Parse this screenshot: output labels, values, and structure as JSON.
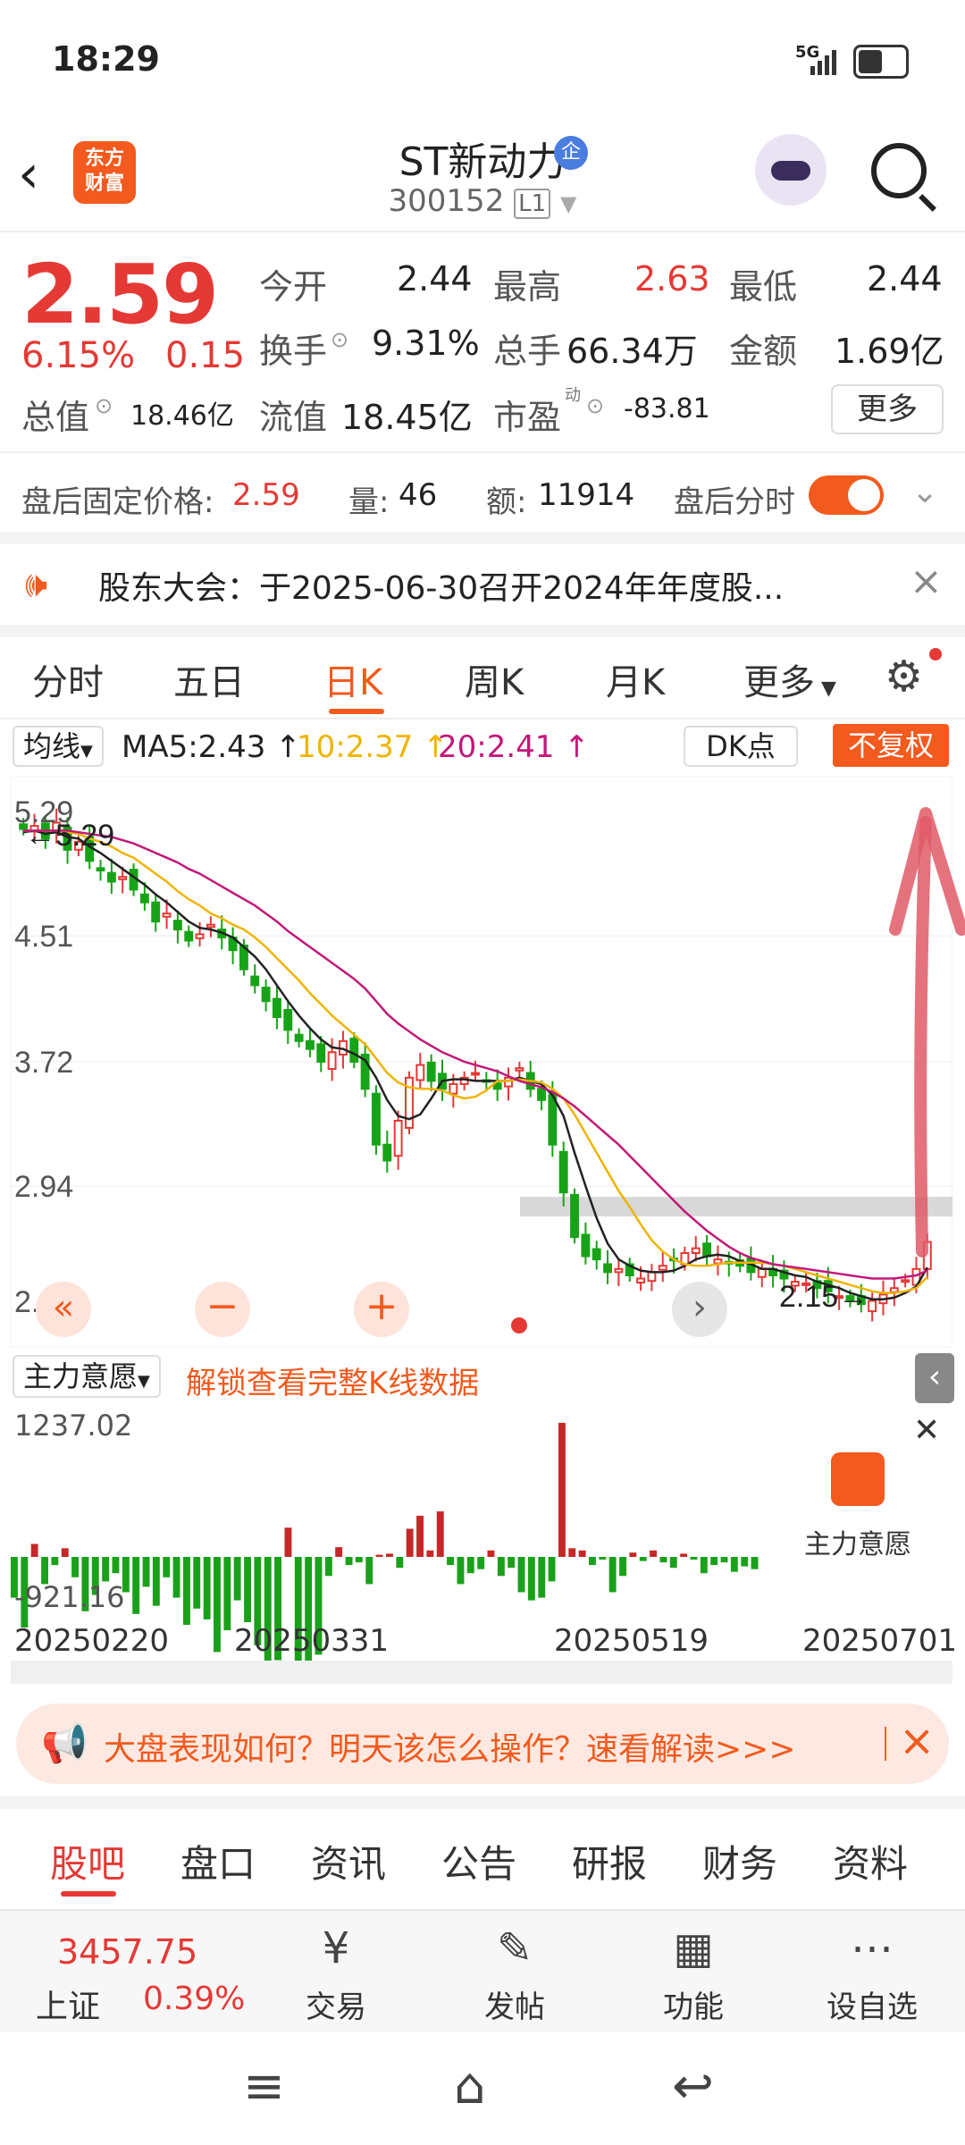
{
  "status": {
    "time": "18:29",
    "network": "5G"
  },
  "header": {
    "logo_line1": "东方",
    "logo_line2": "财富",
    "name": "ST新动力",
    "qi_badge": "企",
    "code": "300152",
    "level": "L1"
  },
  "quote": {
    "price": "2.59",
    "pct": "6.15%",
    "chg": "0.15",
    "row1": [
      {
        "label": "今开",
        "value": "2.44"
      },
      {
        "label": "最高",
        "value": "2.63"
      },
      {
        "label": "最低",
        "value": "2.44"
      }
    ],
    "row2": [
      {
        "label": "换手",
        "value": "9.31%"
      },
      {
        "label": "总手",
        "value": "66.34万"
      },
      {
        "label": "金额",
        "value": "1.69亿"
      }
    ],
    "row3": [
      {
        "label": "总值",
        "value": "18.46亿"
      },
      {
        "label": "流值",
        "value": "18.45亿"
      },
      {
        "label": "市盈",
        "sup": "动",
        "value": "-83.81"
      }
    ],
    "more": "更多"
  },
  "after_hours": {
    "price_label": "盘后固定价格:",
    "price": "2.59",
    "vol_label": "量:",
    "vol": "46",
    "amt_label": "额:",
    "amt": "11914",
    "timeshare_label": "盘后分时"
  },
  "notice": {
    "text": "股东大会：于2025-06-30召开2024年年度股..."
  },
  "ktabs": [
    "分时",
    "五日",
    "日K",
    "周K",
    "月K",
    "更多"
  ],
  "indicator": {
    "select": "均线",
    "ma5": "MA5:2.43 ↑",
    "ma10": "10:2.37 ↑",
    "ma20": "20:2.41 ↑",
    "dk": "DK点",
    "fq": "不复权"
  },
  "chart_data": {
    "type": "candlestick",
    "y_ticks": [
      "5.29",
      "4.51",
      "3.72",
      "2.94",
      "2.15"
    ],
    "ylim": [
      2.15,
      5.29
    ],
    "annotations": [
      "5.29",
      "2.15"
    ],
    "colors": {
      "up": "#e53935",
      "down": "#17a317",
      "ma5": "#222222",
      "ma10": "#f0b400",
      "ma20": "#c2187a"
    },
    "closes": [
      5.18,
      5.2,
      5.12,
      5.22,
      5.05,
      5.1,
      4.98,
      4.92,
      4.85,
      4.88,
      4.8,
      4.72,
      4.6,
      4.65,
      4.55,
      4.48,
      4.52,
      4.58,
      4.5,
      4.42,
      4.3,
      4.2,
      4.1,
      4.0,
      3.92,
      3.85,
      3.8,
      3.72,
      3.78,
      3.85,
      3.72,
      3.55,
      3.2,
      3.1,
      3.35,
      3.62,
      3.7,
      3.6,
      3.55,
      3.58,
      3.62,
      3.65,
      3.6,
      3.55,
      3.62,
      3.68,
      3.55,
      3.48,
      3.2,
      2.9,
      2.62,
      2.5,
      2.48,
      2.4,
      2.42,
      2.38,
      2.36,
      2.4,
      2.44,
      2.48,
      2.52,
      2.55,
      2.5,
      2.48,
      2.46,
      2.44,
      2.4,
      2.42,
      2.38,
      2.36,
      2.34,
      2.33,
      2.3,
      2.28,
      2.25,
      2.22,
      2.2,
      2.22,
      2.26,
      2.3,
      2.35,
      2.42,
      2.59
    ],
    "ma5": [
      5.16,
      5.17,
      5.15,
      5.16,
      5.13,
      5.12,
      5.07,
      5.03,
      4.98,
      4.93,
      4.88,
      4.83,
      4.77,
      4.72,
      4.66,
      4.6,
      4.56,
      4.55,
      4.53,
      4.5,
      4.44,
      4.38,
      4.3,
      4.2,
      4.1,
      4.01,
      3.93,
      3.86,
      3.81,
      3.8,
      3.77,
      3.73,
      3.62,
      3.48,
      3.38,
      3.36,
      3.39,
      3.49,
      3.6,
      3.61,
      3.61,
      3.6,
      3.6,
      3.6,
      3.6,
      3.62,
      3.6,
      3.58,
      3.51,
      3.38,
      3.15,
      2.94,
      2.74,
      2.58,
      2.48,
      2.44,
      2.41,
      2.4,
      2.4,
      2.41,
      2.44,
      2.48,
      2.5,
      2.51,
      2.5,
      2.47,
      2.45,
      2.42,
      2.42,
      2.4,
      2.38,
      2.37,
      2.34,
      2.32,
      2.3,
      2.27,
      2.25,
      2.23,
      2.23,
      2.24,
      2.27,
      2.31,
      2.43
    ],
    "ma10": [
      5.17,
      5.17,
      5.17,
      5.17,
      5.16,
      5.15,
      5.12,
      5.1,
      5.07,
      5.03,
      5.0,
      4.95,
      4.9,
      4.85,
      4.79,
      4.74,
      4.7,
      4.65,
      4.62,
      4.58,
      4.55,
      4.5,
      4.44,
      4.37,
      4.3,
      4.23,
      4.15,
      4.08,
      4.01,
      3.95,
      3.89,
      3.83,
      3.74,
      3.65,
      3.59,
      3.56,
      3.55,
      3.55,
      3.54,
      3.51,
      3.49,
      3.5,
      3.54,
      3.6,
      3.6,
      3.61,
      3.6,
      3.59,
      3.55,
      3.49,
      3.39,
      3.27,
      3.15,
      3.03,
      2.91,
      2.81,
      2.7,
      2.6,
      2.53,
      2.48,
      2.45,
      2.44,
      2.44,
      2.45,
      2.46,
      2.46,
      2.46,
      2.46,
      2.45,
      2.44,
      2.42,
      2.4,
      2.38,
      2.36,
      2.34,
      2.32,
      2.3,
      2.28,
      2.27,
      2.27,
      2.28,
      2.3,
      2.37
    ],
    "ma20": [
      5.17,
      5.17,
      5.17,
      5.17,
      5.17,
      5.16,
      5.15,
      5.14,
      5.13,
      5.11,
      5.09,
      5.06,
      5.03,
      5.0,
      4.97,
      4.93,
      4.9,
      4.86,
      4.82,
      4.78,
      4.74,
      4.7,
      4.65,
      4.6,
      4.54,
      4.49,
      4.44,
      4.39,
      4.34,
      4.29,
      4.24,
      4.18,
      4.1,
      4.02,
      3.96,
      3.91,
      3.86,
      3.82,
      3.78,
      3.75,
      3.72,
      3.7,
      3.68,
      3.66,
      3.63,
      3.6,
      3.58,
      3.56,
      3.53,
      3.49,
      3.44,
      3.38,
      3.32,
      3.26,
      3.2,
      3.13,
      3.06,
      2.99,
      2.92,
      2.85,
      2.78,
      2.72,
      2.66,
      2.61,
      2.56,
      2.52,
      2.49,
      2.47,
      2.45,
      2.44,
      2.43,
      2.42,
      2.41,
      2.4,
      2.39,
      2.38,
      2.37,
      2.36,
      2.36,
      2.36,
      2.37,
      2.38,
      2.41
    ]
  },
  "flow": {
    "select": "主力意愿",
    "unlock": "解锁查看完整K线数据",
    "y_max": "1237.02",
    "y_min": "-921.16",
    "dates": [
      "20250220",
      "20250331",
      "20250519",
      "20250701"
    ],
    "box_label": "主力意愿",
    "values": [
      -300,
      -520,
      120,
      -200,
      -60,
      80,
      -150,
      -400,
      -280,
      -180,
      -120,
      -260,
      -420,
      -220,
      -360,
      -150,
      -300,
      -500,
      -380,
      -460,
      -700,
      -540,
      -320,
      -480,
      -650,
      -850,
      -760,
      270,
      -890,
      -920,
      -720,
      -140,
      90,
      -60,
      -40,
      -200,
      20,
      30,
      -80,
      260,
      380,
      60,
      420,
      -60,
      -200,
      -120,
      -90,
      60,
      -140,
      -80,
      -260,
      -320,
      -300,
      -180,
      1237,
      80,
      60,
      -60,
      -20,
      -260,
      -140,
      40,
      -30,
      60,
      -40,
      -80,
      30,
      -20,
      -120,
      -60,
      -40,
      -110,
      -70,
      -90
    ]
  },
  "banner": {
    "text": "大盘表现如何？明天该怎么操作？速看解读>>>"
  },
  "content_tabs": [
    "股吧",
    "盘口",
    "资讯",
    "公告",
    "研报",
    "财务",
    "资料"
  ],
  "bottom_bar": {
    "index_val": "3457.75",
    "index_name": "上证",
    "index_pct": "0.39%",
    "items": [
      {
        "label": "交易",
        "icon": "¥"
      },
      {
        "label": "发帖",
        "icon": "✎"
      },
      {
        "label": "功能",
        "icon": "▦"
      },
      {
        "label": "设自选",
        "icon": "⋯"
      }
    ]
  }
}
